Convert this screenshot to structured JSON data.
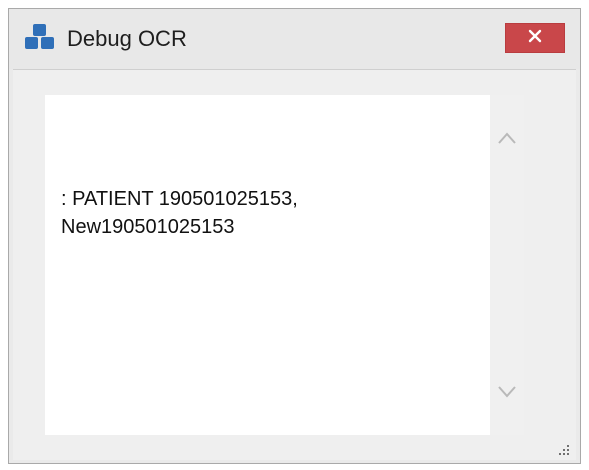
{
  "window": {
    "title": "Debug OCR",
    "icon": "blue-cubes-icon",
    "close_icon": "close-icon"
  },
  "ocr_output": {
    "lines": [
      ": PATIENT 190501025153,",
      "New190501025153"
    ]
  },
  "scrollbar": {
    "up_icon": "chevron-up-icon",
    "down_icon": "chevron-down-icon"
  },
  "colors": {
    "title_bar": "#e8e8e8",
    "close_button": "#c9474a",
    "icon_blue": "#2f6fb8",
    "text_area": "#ffffff"
  }
}
